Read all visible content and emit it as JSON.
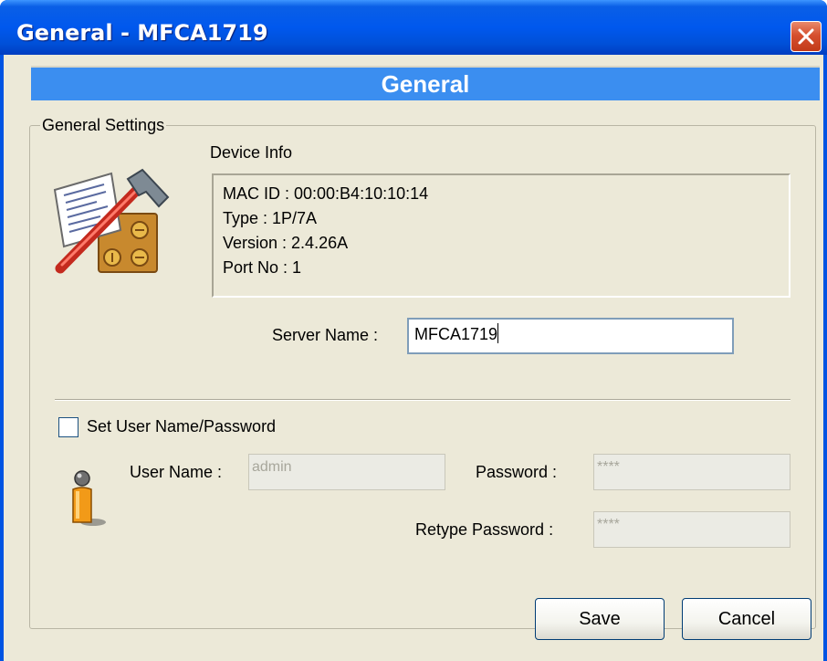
{
  "window": {
    "title": "General - MFCA1719"
  },
  "header": {
    "title": "General"
  },
  "general_settings": {
    "legend": "General Settings",
    "device_info_label": "Device Info",
    "device_info": {
      "mac": "MAC ID : 00:00:B4:10:10:14",
      "type": "Type : 1P/7A",
      "version": "Version : 2.4.26A",
      "port": "Port No : 1"
    },
    "server_name_label": "Server Name :",
    "server_name_value": "MFCA1719",
    "set_credentials_label": "Set User Name/Password",
    "set_credentials_checked": false,
    "user_name_label": "User Name :",
    "user_name_value": "admin",
    "password_label": "Password :",
    "password_value": "****",
    "retype_password_label": "Retype Password :",
    "retype_password_value": "****"
  },
  "buttons": {
    "save": "Save",
    "cancel": "Cancel"
  },
  "icons": {
    "settings_tool": "document-hammer-settings-icon",
    "user": "user-icon",
    "close": "close-icon"
  },
  "colors": {
    "titlebar": "#0058ee",
    "header_band": "#3b8ef0",
    "dialog_bg": "#ece9d8",
    "close_button": "#d6502f"
  }
}
